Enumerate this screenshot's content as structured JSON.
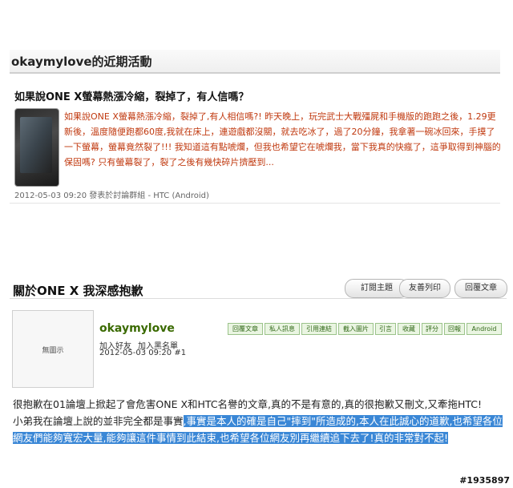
{
  "activity": {
    "heading": "okaymylove的近期活動",
    "post_title": "如果說ONE X螢幕熱漲冷縮，裂掉了，有人信嗎？",
    "excerpt": "如果說ONE X螢幕熱漲冷縮，裂掉了,有人相信嗎?! 昨天晚上，玩完武士大戰殭屍和手機版的跑跑之後，1.29更新後，溫度隨便跑都60度,我就在床上，連遊戲都沒關，就去吃冰了，過了20分鐘，我拿著一碗冰回來，手摸了一下螢幕，螢幕竟然裂了!!! 我知道這有點唬爛，但我也希望它在唬爛我，當下我真的快瘋了，這爭取得到神腦的保固嗎? 只有螢幕裂了，裂了之後有幾快碎片擠壓到...",
    "meta": "2012-05-03 09:20 發表於討論群組 - HTC (Android)"
  },
  "topic": {
    "title": "關於ONE X 我深感抱歉",
    "buttons": [
      "訂閱主題",
      "友善列印",
      "回覆文章"
    ]
  },
  "post": {
    "avatar_text": "無圖示",
    "username": "okaymylove",
    "add_friend": "加入好友",
    "add_blacklist": "加入黑名單",
    "datetime": "2012-05-03 09:20",
    "floor": "#1",
    "tags": [
      "回覆文章",
      "私人訊息",
      "引用連結",
      "截入圖片",
      "引言",
      "收藏",
      "評分",
      "回報",
      "Android"
    ],
    "body_p1": "很抱歉在01論壇上掀起了會危害ONE X和HTC名譽的文章,真的不是有意的,真的很抱歉又刪文,又牽拖HTC!",
    "body_p2_plain": "小弟我在論壇上說的並非完全都是事實",
    "body_p2_highlight": ",事實是本人的確是自己\"摔到\"所造成的,本人在此誠心的道歉,也希望各位網友們能夠寬宏大量,能夠讓這件事情到此結束,也希望各位網友別再繼續追下去了!真的非常對不起!"
  },
  "watermark": "#1935897"
}
